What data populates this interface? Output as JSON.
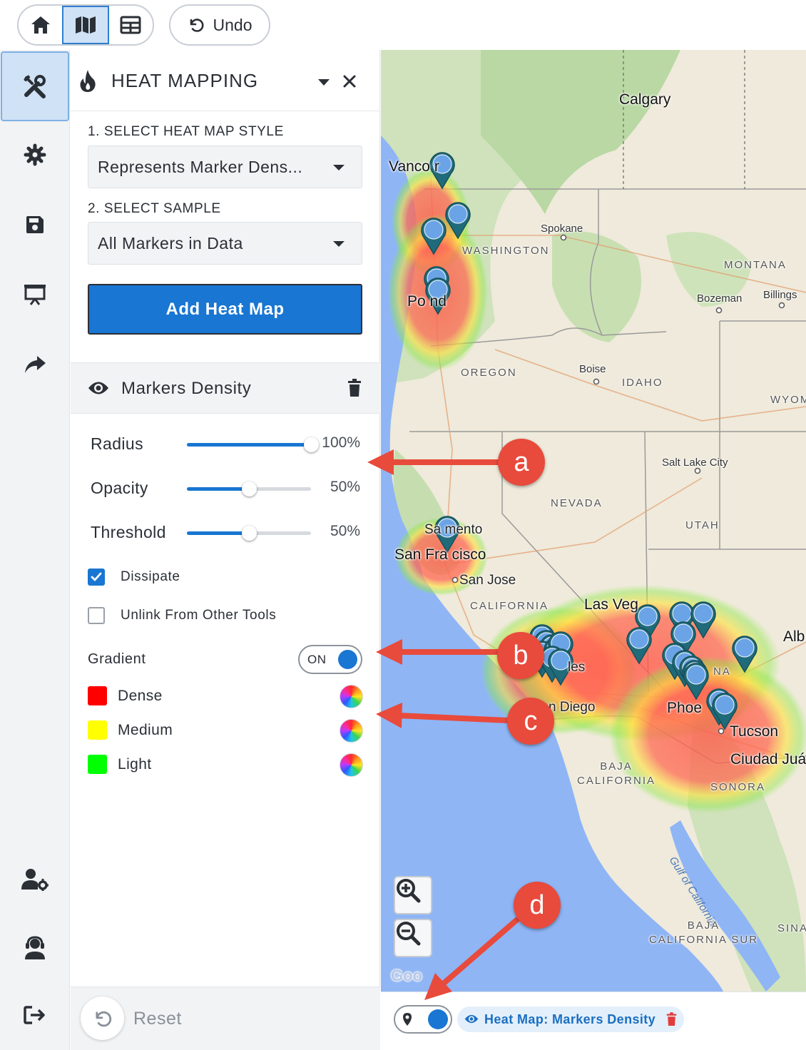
{
  "toolbar": {
    "views": [
      "home-icon",
      "map-icon",
      "table-icon"
    ],
    "active_view": "map-icon",
    "undo_label": "Undo"
  },
  "rail": {
    "items": [
      "tools-icon",
      "gear-icon",
      "save-icon",
      "presentation-icon",
      "share-icon"
    ],
    "bottom_items": [
      "user-settings-icon",
      "support-icon",
      "logout-icon"
    ]
  },
  "panel": {
    "title": "HEAT MAPPING",
    "step1_label": "1. SELECT HEAT MAP STYLE",
    "style_value": "Represents Marker Dens...",
    "step2_label": "2. SELECT SAMPLE",
    "sample_value": "All Markers in Data",
    "add_button": "Add Heat Map",
    "layer_name": "Markers Density",
    "sliders": [
      {
        "label": "Radius",
        "value": "100%",
        "fraction": 1.0
      },
      {
        "label": "Opacity",
        "value": "50%",
        "fraction": 0.5
      },
      {
        "label": "Threshold",
        "value": "50%",
        "fraction": 0.5
      }
    ],
    "dissipate_label": "Dissipate",
    "dissipate_checked": true,
    "unlink_label": "Unlink From Other Tools",
    "unlink_checked": false,
    "gradient_label": "Gradient",
    "gradient_toggle": "ON",
    "colors": [
      {
        "name": "Dense",
        "color": "#ff0000"
      },
      {
        "name": "Medium",
        "color": "#ffff00"
      },
      {
        "name": "Light",
        "color": "#00ff00"
      }
    ],
    "reset_label": "Reset"
  },
  "map": {
    "labels": {
      "calgary": "Calgary",
      "vancouver": "Vanco    r",
      "spokane": "Spokane",
      "washington": "WASHINGTON",
      "montana": "MONTANA",
      "bozeman": "Bozeman",
      "billings": "Billings",
      "portland": "Po     nd",
      "oregon": "OREGON",
      "boise": "Boise",
      "idaho": "IDAHO",
      "wyoming": "WYOM",
      "salt_lake": "Salt Lake City",
      "nevada": "NEVADA",
      "utah": "UTAH",
      "sacramento": "Sa     mento",
      "san_francisco": "San Fra   cisco",
      "san_jose": "San Jose",
      "california": "CALIFORNIA",
      "las_vegas": "Las Veg",
      "albuquerque": "Alb",
      "los_angeles": "les",
      "arizona": "NA",
      "san_diego": "n Diego",
      "phoenix": "Phoe",
      "tucson": "Tucson",
      "ciudad_juarez": "Ciudad Juá",
      "baja_california": "BAJA\nCALIFORNIA",
      "sonora": "SONORA",
      "gulf": "Gulf of California",
      "baja_sur": "BAJA\nCALIFORNIA SUR",
      "sina": "SINA",
      "google": "Goo"
    }
  },
  "mapbar": {
    "layer_chip": "Heat Map: Markers Density"
  },
  "callouts": [
    "a",
    "b",
    "c",
    "d"
  ]
}
